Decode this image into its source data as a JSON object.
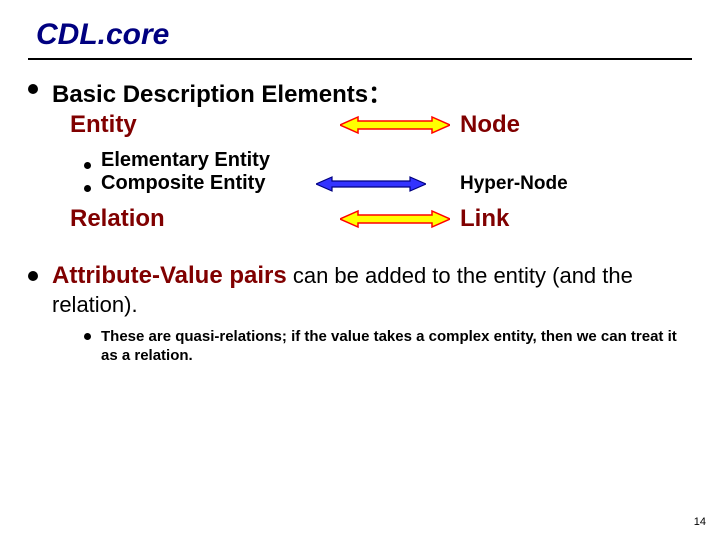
{
  "title": "CDL.core",
  "heading": "Basic Description Elements：",
  "pairs": {
    "entity": {
      "left": "Entity",
      "right": "Node"
    },
    "relation": {
      "left": "Relation",
      "right": "Link"
    }
  },
  "sub": {
    "elementary": "Elementary Entity",
    "composite": "Composite Entity",
    "hyper": "Hyper-Node"
  },
  "av": {
    "bold": "Attribute-Value pairs",
    "rest": " can be added to the entity (and the relation)."
  },
  "note": "These are quasi-relations; if the value takes a complex entity, then we can treat it as a relation.",
  "pagenum": "14",
  "arrow_colors": {
    "yellow_fill": "#ffff00",
    "red_stroke": "#ff0000",
    "blue_fill": "#3333ff",
    "blue_stroke": "#000080"
  }
}
